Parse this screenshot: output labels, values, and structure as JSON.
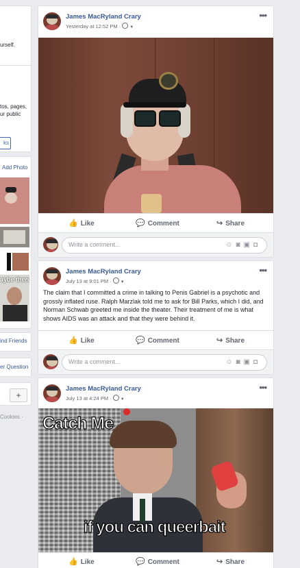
{
  "left_column": {
    "intro_frag": "urself.",
    "photos_frag1": "tos, pages,",
    "photos_frag2": "ur public",
    "links_btn": "ks",
    "add_photo": "Add Photo",
    "maybe_text": "aybe there",
    "find_friends": "ind Friends",
    "question": "er Question",
    "plus": "+",
    "cookies": "Cookies ·"
  },
  "posts": [
    {
      "author": "James MacRyland Crary",
      "time": "Yesterday at 12:52 PM ·",
      "actions": {
        "like": "Like",
        "comment": "Comment",
        "share": "Share"
      },
      "comment_placeholder": "Write a comment..."
    },
    {
      "author": "James MacRyland Crary",
      "time": "July 13 at 9:01 PM ·",
      "text": "The claim that I committed a crime in talking to Penis Gabriel is a psychotic and grossly inflated ruse. Ralph Marzlak told me to ask for Bill Parks, which I did, and Norman Schwab greeted me inside the theater. Their treatment of me is what shows AIDS was an attack and that they were behind it.",
      "actions": {
        "like": "Like",
        "comment": "Comment",
        "share": "Share"
      },
      "comment_placeholder": "Write a comment..."
    },
    {
      "author": "James MacRyland Crary",
      "time": "July 13 at 4:24 PM ·",
      "meme_top": "Catch Me",
      "meme_bottom": "if you can queerbait",
      "actions": {
        "like": "Like",
        "comment": "Comment",
        "share": "Share"
      }
    }
  ],
  "icons": {
    "more": "more-options-icon",
    "like": "thumbs-up-icon",
    "comment": "speech-bubble-icon",
    "share": "share-arrow-icon",
    "privacy": "globe-icon"
  },
  "colors": {
    "link": "#365899",
    "bg": "#e9ebee",
    "border": "#dddfe2"
  }
}
